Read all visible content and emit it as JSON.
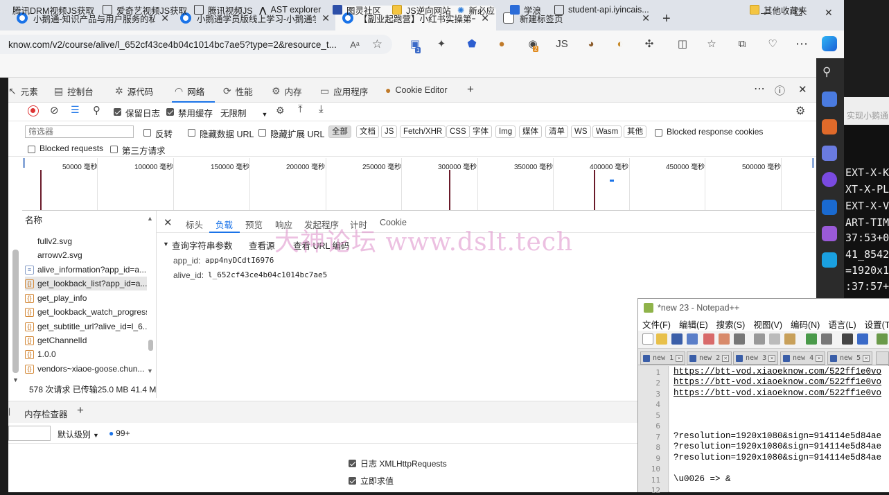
{
  "browser": {
    "tabs": [
      {
        "label": "小鹅通-知识产品与用户服务的私",
        "active": false
      },
      {
        "label": "小鹅通学员版线上学习-小鹅通学",
        "active": false
      },
      {
        "label": "【副业起跑营】小红书实操第一",
        "active": true
      },
      {
        "label": "新建标签页",
        "active": false
      }
    ],
    "address": "know.com/v2/course/alive/l_652cf43ce4b04c1014bc7ae5?type=2&resource_t...",
    "ext_badges": {
      "badge1": "1",
      "badge2": "2"
    },
    "bookmarks": [
      {
        "label": "腾讯DRM视频JS获取",
        "icon": "page-icon"
      },
      {
        "label": "爱奇艺视频JS获取",
        "icon": "page-icon"
      },
      {
        "label": "腾讯视频JS",
        "icon": "page-icon"
      },
      {
        "label": "AST explorer",
        "icon": "ast-icon"
      },
      {
        "label": "图灵社区",
        "icon": "turing-icon"
      },
      {
        "label": "JS逆向网站",
        "icon": "folder-icon"
      },
      {
        "label": "新必应",
        "icon": "bing-icon"
      },
      {
        "label": "学浪",
        "icon": "xuelang-icon"
      },
      {
        "label": "student-api.iyincais...",
        "icon": "page-icon"
      }
    ],
    "other_bookmarks": "其他收藏夹"
  },
  "devtools": {
    "tabs": [
      {
        "label": "元素",
        "icon": "elements-icon"
      },
      {
        "label": "控制台",
        "icon": "console-icon"
      },
      {
        "label": "源代码",
        "icon": "sources-icon"
      },
      {
        "label": "网络",
        "icon": "wifi-icon",
        "active": true
      },
      {
        "label": "性能",
        "icon": "performance-icon"
      },
      {
        "label": "内存",
        "icon": "memory-icon"
      },
      {
        "label": "应用程序",
        "icon": "application-icon"
      },
      {
        "label": "Cookie Editor",
        "icon": "cookie-icon"
      }
    ],
    "toolbar": {
      "preserve_log": "保留日志",
      "disable_cache": "禁用缓存",
      "throttle": "无限制"
    },
    "filter": {
      "placeholder": "筛选器",
      "invert": "反转",
      "hide_data_urls": "隐藏数据 URL",
      "hide_ext_urls": "隐藏扩展 URL",
      "types": [
        "全部",
        "文档",
        "JS",
        "Fetch/XHR",
        "CSS",
        "字体",
        "Img",
        "媒体",
        "清单",
        "WS",
        "Wasm",
        "其他"
      ],
      "blocked_cookies": "Blocked response cookies",
      "blocked_requests": "Blocked requests",
      "third_party": "第三方请求"
    },
    "timeline": {
      "ticks": [
        "50000 毫秒",
        "100000 毫秒",
        "150000 毫秒",
        "200000 毫秒",
        "250000 毫秒",
        "300000 毫秒",
        "350000 毫秒",
        "400000 毫秒",
        "450000 毫秒",
        "500000 毫秒"
      ]
    },
    "requests": {
      "header": "名称",
      "items": [
        {
          "name": "fullv2.svg",
          "icon": "none"
        },
        {
          "name": "arrowv2.svg",
          "icon": "none"
        },
        {
          "name": "alive_information?app_id=a...",
          "icon": "doc"
        },
        {
          "name": "get_lookback_list?app_id=a...",
          "icon": "xhr",
          "selected": true
        },
        {
          "name": "get_play_info",
          "icon": "xhr"
        },
        {
          "name": "get_lookback_watch_progress",
          "icon": "xhr"
        },
        {
          "name": "get_subtitle_url?alive_id=l_6...",
          "icon": "xhr"
        },
        {
          "name": "getChannelId",
          "icon": "xhr"
        },
        {
          "name": "1.0.0",
          "icon": "xhr"
        },
        {
          "name": "vendors~xiaoe-goose.chun...",
          "icon": "xhr"
        }
      ],
      "status": "578 次请求  已传输25.0 MB  41.4 M"
    },
    "detail": {
      "tabs": [
        "标头",
        "负载",
        "预览",
        "响应",
        "发起程序",
        "计时",
        "Cookie"
      ],
      "active_tab": "负载",
      "section": "查询字符串参数",
      "view_source": "查看源",
      "view_url_encoded": "查看 URL 编码",
      "params": [
        {
          "key": "app_id:",
          "value": "app4nyDCdtI6976"
        },
        {
          "key": "alive_id:",
          "value": "l_652cf43ce4b04c1014bc7ae5"
        }
      ]
    },
    "drawer": {
      "tab": "内存检查器",
      "level": "默认级别",
      "count": "99+",
      "options": [
        "日志 XMLHttpRequests",
        "立即求值"
      ]
    }
  },
  "watermark": "大神论坛   www.dslt.tech",
  "background_window": {
    "top_text": "实现小鹅通",
    "lines": [
      "EXT-X-K",
      "XT-X-PL",
      "EXT-X-V",
      "ART-TIME",
      "37:53+0",
      "41_8542",
      "=1920x1",
      ":37:57+"
    ]
  },
  "notepad": {
    "title": "*new 23 - Notepad++",
    "menu": [
      "文件(F)",
      "编辑(E)",
      "搜索(S)",
      "视图(V)",
      "编码(N)",
      "语言(L)",
      "设置(T)"
    ],
    "tabs": [
      "new 1",
      "new 2",
      "new 3",
      "new 4",
      "new 5"
    ],
    "lines": [
      {
        "n": "1",
        "text": "https://btt-vod.xiaoeknow.com/522ff1e0vo",
        "link": true
      },
      {
        "n": "2",
        "text": "https://btt-vod.xiaoeknow.com/522ff1e0vo",
        "link": true
      },
      {
        "n": "3",
        "text": "https://btt-vod.xiaoeknow.com/522ff1e0vo",
        "link": true
      },
      {
        "n": "4",
        "text": ""
      },
      {
        "n": "5",
        "text": ""
      },
      {
        "n": "6",
        "text": ""
      },
      {
        "n": "7",
        "text": "?resolution=1920x1080&sign=914114e5d84ae"
      },
      {
        "n": "8",
        "text": "?resolution=1920x1080&sign=914114e5d84ae"
      },
      {
        "n": "9",
        "text": "?resolution=1920x1080&sign=914114e5d84ae"
      },
      {
        "n": "10",
        "text": ""
      },
      {
        "n": "11",
        "text": "\\u0026 => &"
      },
      {
        "n": "12",
        "text": ""
      }
    ]
  }
}
